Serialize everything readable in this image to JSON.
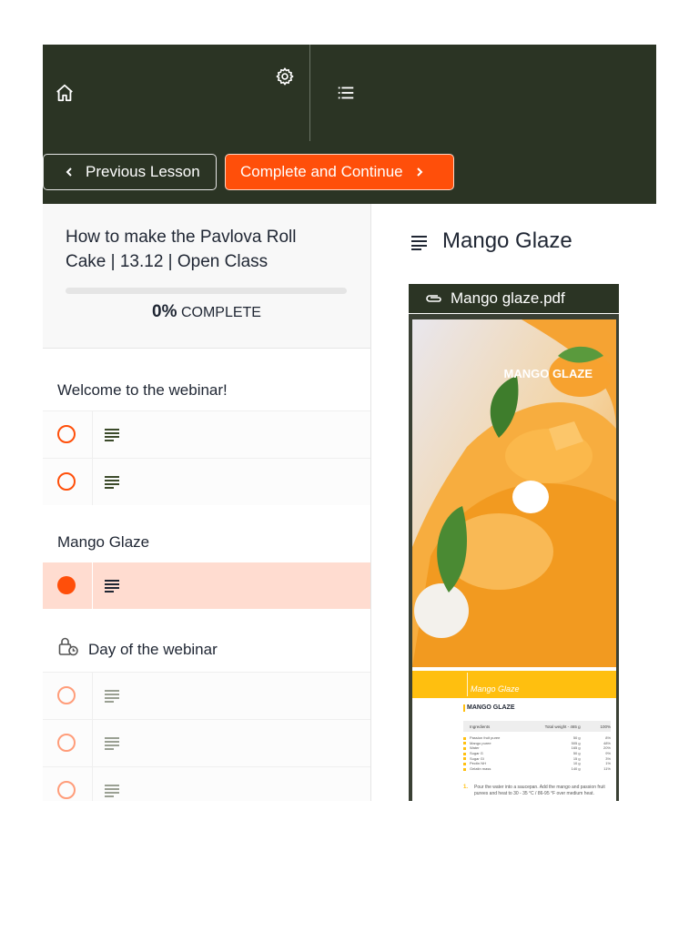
{
  "colors": {
    "header_bg": "#2b3424",
    "accent": "#ff4f0a",
    "active_row": "#ffdcd0",
    "pdf_banner": "#ffbf0f"
  },
  "header": {
    "icons": [
      "home-icon",
      "gear-icon",
      "menu-list-icon"
    ],
    "prev_label": "Previous Lesson",
    "next_label": "Complete and Continue"
  },
  "course": {
    "title": "How to make the Pavlova Roll Cake | 13.12 | Open Class",
    "progress_percent": "0%",
    "progress_label": "COMPLETE",
    "progress_value": 0
  },
  "sidebar": {
    "sections": [
      {
        "title": "Welcome to the webinar!",
        "locked": false,
        "lessons": [
          {
            "status": "open"
          },
          {
            "status": "open"
          }
        ]
      },
      {
        "title": "Mango Glaze",
        "locked": false,
        "lessons": [
          {
            "status": "current"
          }
        ]
      },
      {
        "title": "Day of the webinar",
        "locked": true,
        "lessons": [
          {
            "status": "locked"
          },
          {
            "status": "locked"
          },
          {
            "status": "locked"
          }
        ]
      }
    ]
  },
  "content": {
    "title": "Mango Glaze",
    "attachment_name": "Mango glaze.pdf",
    "pdf": {
      "hero_title": "MANGO GLAZE",
      "banner_text": "Mango Glaze",
      "section_title": "MANGO GLAZE",
      "table_head": [
        "Ingredients",
        "Total weight - 465 g",
        "100%"
      ],
      "rows": [
        [
          "Passion fruit puree",
          "50 g",
          "8%"
        ],
        [
          "Mango puree",
          "505 g",
          "48%"
        ],
        [
          "Water",
          "165 g",
          "20%"
        ],
        [
          "Sugar G",
          "50 g",
          "9%"
        ],
        [
          "Sugar Gl",
          "15 g",
          "3%"
        ],
        [
          "Pectin NH",
          "10 g",
          "1%"
        ],
        [
          "Gelatin mass",
          "140 g",
          "11%"
        ]
      ],
      "step_number": "1.",
      "step_text": "Pour the water into a saucepan. Add the mango and passion fruit purees and heat to 30 - 35 °C / 86-95 °F over medium heat."
    }
  }
}
